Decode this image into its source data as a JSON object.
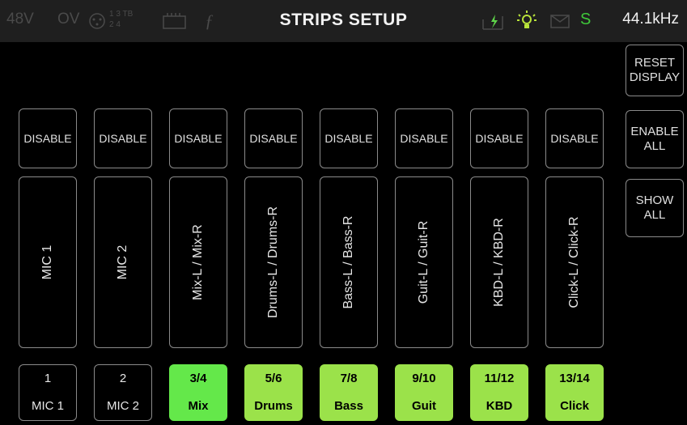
{
  "status": {
    "phantom": "48V",
    "overload": "OV",
    "routing_top": "1 3 TB",
    "routing_bottom": "2 4",
    "title": "STRIPS SETUP",
    "sync": "S",
    "sample_rate": "44.1kHz"
  },
  "side": {
    "reset_line1": "RESET",
    "reset_line2": "DISPLAY",
    "enable_line1": "ENABLE",
    "enable_line2": "ALL",
    "show_line1": "SHOW",
    "show_line2": "ALL"
  },
  "strips": [
    {
      "disable": "DISABLE",
      "name": "MIC 1",
      "num": "1",
      "short": "MIC 1",
      "active": false
    },
    {
      "disable": "DISABLE",
      "name": "MIC 2",
      "num": "2",
      "short": "MIC 2",
      "active": false
    },
    {
      "disable": "DISABLE",
      "name": "Mix-L / Mix-R",
      "num": "3/4",
      "short": "Mix",
      "active": true
    },
    {
      "disable": "DISABLE",
      "name": "Drums-L / Drums-R",
      "num": "5/6",
      "short": "Drums",
      "active": true
    },
    {
      "disable": "DISABLE",
      "name": "Bass-L / Bass-R",
      "num": "7/8",
      "short": "Bass",
      "active": true
    },
    {
      "disable": "DISABLE",
      "name": "Guit-L / Guit-R",
      "num": "9/10",
      "short": "Guit",
      "active": true
    },
    {
      "disable": "DISABLE",
      "name": "KBD-L / KBD-R",
      "num": "11/12",
      "short": "KBD",
      "active": true
    },
    {
      "disable": "DISABLE",
      "name": "Click-L / Click-R",
      "num": "13/14",
      "short": "Click",
      "active": true
    }
  ],
  "colors": {
    "active_green": "#9be24a",
    "selected_green": "#64e84a",
    "sync_green": "#3fc83a",
    "power_green": "#5fd64a"
  }
}
